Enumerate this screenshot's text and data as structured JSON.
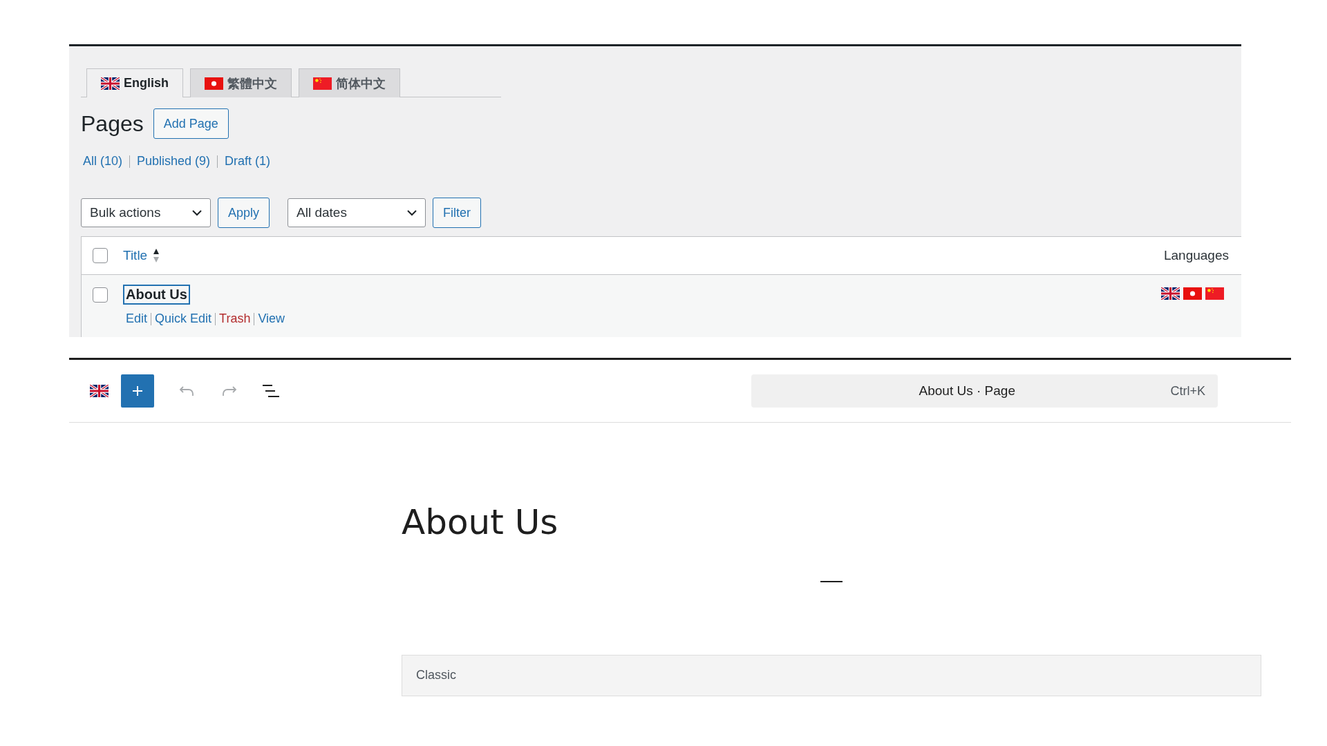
{
  "language_tabs": [
    {
      "label": "English",
      "selected": true
    },
    {
      "label": "繁體中文",
      "selected": false
    },
    {
      "label": "简体中文",
      "selected": false
    }
  ],
  "heading": {
    "title": "Pages",
    "add_button": "Add Page"
  },
  "status_filters": [
    {
      "label": "All",
      "count": "(10)"
    },
    {
      "label": "Published",
      "count": "(9)"
    },
    {
      "label": "Draft",
      "count": "(1)"
    }
  ],
  "bulk_actions": {
    "value": "Bulk actions",
    "button": "Apply"
  },
  "date_filter": {
    "value": "All dates",
    "button": "Filter"
  },
  "table": {
    "columns": [
      "Title",
      "Languages"
    ],
    "select_all_checked": false,
    "rows": [
      {
        "title": "About Us",
        "focused": true,
        "checked": false,
        "actions": [
          {
            "label": "Edit",
            "kind": "link"
          },
          {
            "label": "Quick Edit",
            "kind": "link"
          },
          {
            "label": "Trash",
            "kind": "delete"
          },
          {
            "label": "View",
            "kind": "link"
          }
        ]
      }
    ]
  },
  "editor": {
    "command_bar": {
      "title": "About Us · Page",
      "shortcut": "Ctrl+K"
    },
    "post_title": "About Us",
    "classic_block": {
      "label": "Classic"
    }
  }
}
